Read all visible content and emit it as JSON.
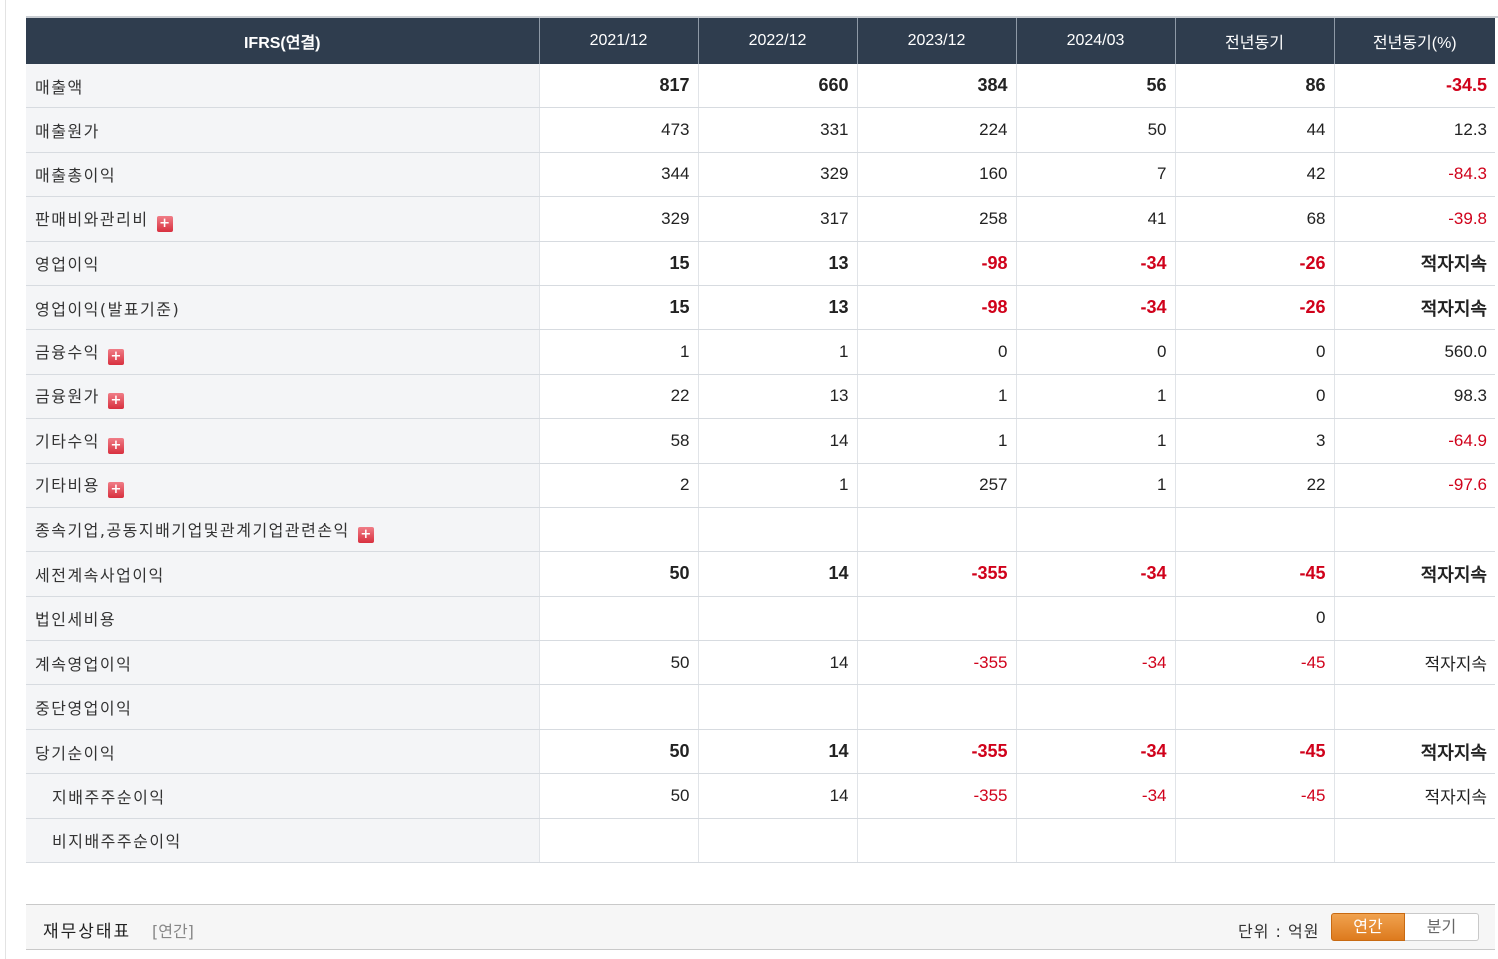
{
  "header": {
    "label": "IFRS(연결)",
    "cols": [
      "2021/12",
      "2022/12",
      "2023/12",
      "2024/03",
      "전년동기",
      "전년동기(%)"
    ]
  },
  "rows": [
    {
      "label": "매출액",
      "bold": true,
      "expand": false,
      "indent": false,
      "values": [
        "817",
        "660",
        "384",
        "56",
        "86",
        "-34.5"
      ]
    },
    {
      "label": "매출원가",
      "bold": false,
      "expand": false,
      "indent": false,
      "values": [
        "473",
        "331",
        "224",
        "50",
        "44",
        "12.3"
      ]
    },
    {
      "label": "매출총이익",
      "bold": false,
      "expand": false,
      "indent": false,
      "values": [
        "344",
        "329",
        "160",
        "7",
        "42",
        "-84.3"
      ]
    },
    {
      "label": "판매비와관리비",
      "bold": false,
      "expand": true,
      "indent": false,
      "values": [
        "329",
        "317",
        "258",
        "41",
        "68",
        "-39.8"
      ]
    },
    {
      "label": "영업이익",
      "bold": true,
      "expand": false,
      "indent": false,
      "values": [
        "15",
        "13",
        "-98",
        "-34",
        "-26",
        "적자지속"
      ]
    },
    {
      "label": "영업이익(발표기준)",
      "bold": true,
      "expand": false,
      "indent": false,
      "values": [
        "15",
        "13",
        "-98",
        "-34",
        "-26",
        "적자지속"
      ]
    },
    {
      "label": "금융수익",
      "bold": false,
      "expand": true,
      "indent": false,
      "values": [
        "1",
        "1",
        "0",
        "0",
        "0",
        "560.0"
      ]
    },
    {
      "label": "금융원가",
      "bold": false,
      "expand": true,
      "indent": false,
      "values": [
        "22",
        "13",
        "1",
        "1",
        "0",
        "98.3"
      ]
    },
    {
      "label": "기타수익",
      "bold": false,
      "expand": true,
      "indent": false,
      "values": [
        "58",
        "14",
        "1",
        "1",
        "3",
        "-64.9"
      ]
    },
    {
      "label": "기타비용",
      "bold": false,
      "expand": true,
      "indent": false,
      "values": [
        "2",
        "1",
        "257",
        "1",
        "22",
        "-97.6"
      ]
    },
    {
      "label": "종속기업,공동지배기업및관계기업관련손익",
      "bold": false,
      "expand": true,
      "indent": false,
      "values": [
        "",
        "",
        "",
        "",
        "",
        ""
      ]
    },
    {
      "label": "세전계속사업이익",
      "bold": true,
      "expand": false,
      "indent": false,
      "values": [
        "50",
        "14",
        "-355",
        "-34",
        "-45",
        "적자지속"
      ]
    },
    {
      "label": "법인세비용",
      "bold": false,
      "expand": false,
      "indent": false,
      "values": [
        "",
        "",
        "",
        "",
        "0",
        ""
      ]
    },
    {
      "label": "계속영업이익",
      "bold": false,
      "expand": false,
      "indent": false,
      "values": [
        "50",
        "14",
        "-355",
        "-34",
        "-45",
        "적자지속"
      ]
    },
    {
      "label": "중단영업이익",
      "bold": false,
      "expand": false,
      "indent": false,
      "values": [
        "",
        "",
        "",
        "",
        "",
        ""
      ]
    },
    {
      "label": "당기순이익",
      "bold": true,
      "expand": false,
      "indent": false,
      "values": [
        "50",
        "14",
        "-355",
        "-34",
        "-45",
        "적자지속"
      ]
    },
    {
      "label": "지배주주순이익",
      "bold": false,
      "expand": false,
      "indent": true,
      "values": [
        "50",
        "14",
        "-355",
        "-34",
        "-45",
        "적자지속"
      ]
    },
    {
      "label": "비지배주주순이익",
      "bold": false,
      "expand": false,
      "indent": true,
      "values": [
        "",
        "",
        "",
        "",
        "",
        ""
      ]
    }
  ],
  "expand_icon": "plus-box-icon",
  "colors": {
    "header_bg": "#2f3d4e",
    "negative": "#d0021b",
    "active_tab": "#e8892c"
  },
  "footer": {
    "title": "재무상태표",
    "subtitle": "[연간]",
    "unit": "단위 : 억원",
    "tabs": [
      "연간",
      "분기"
    ],
    "active_tab": "연간"
  }
}
